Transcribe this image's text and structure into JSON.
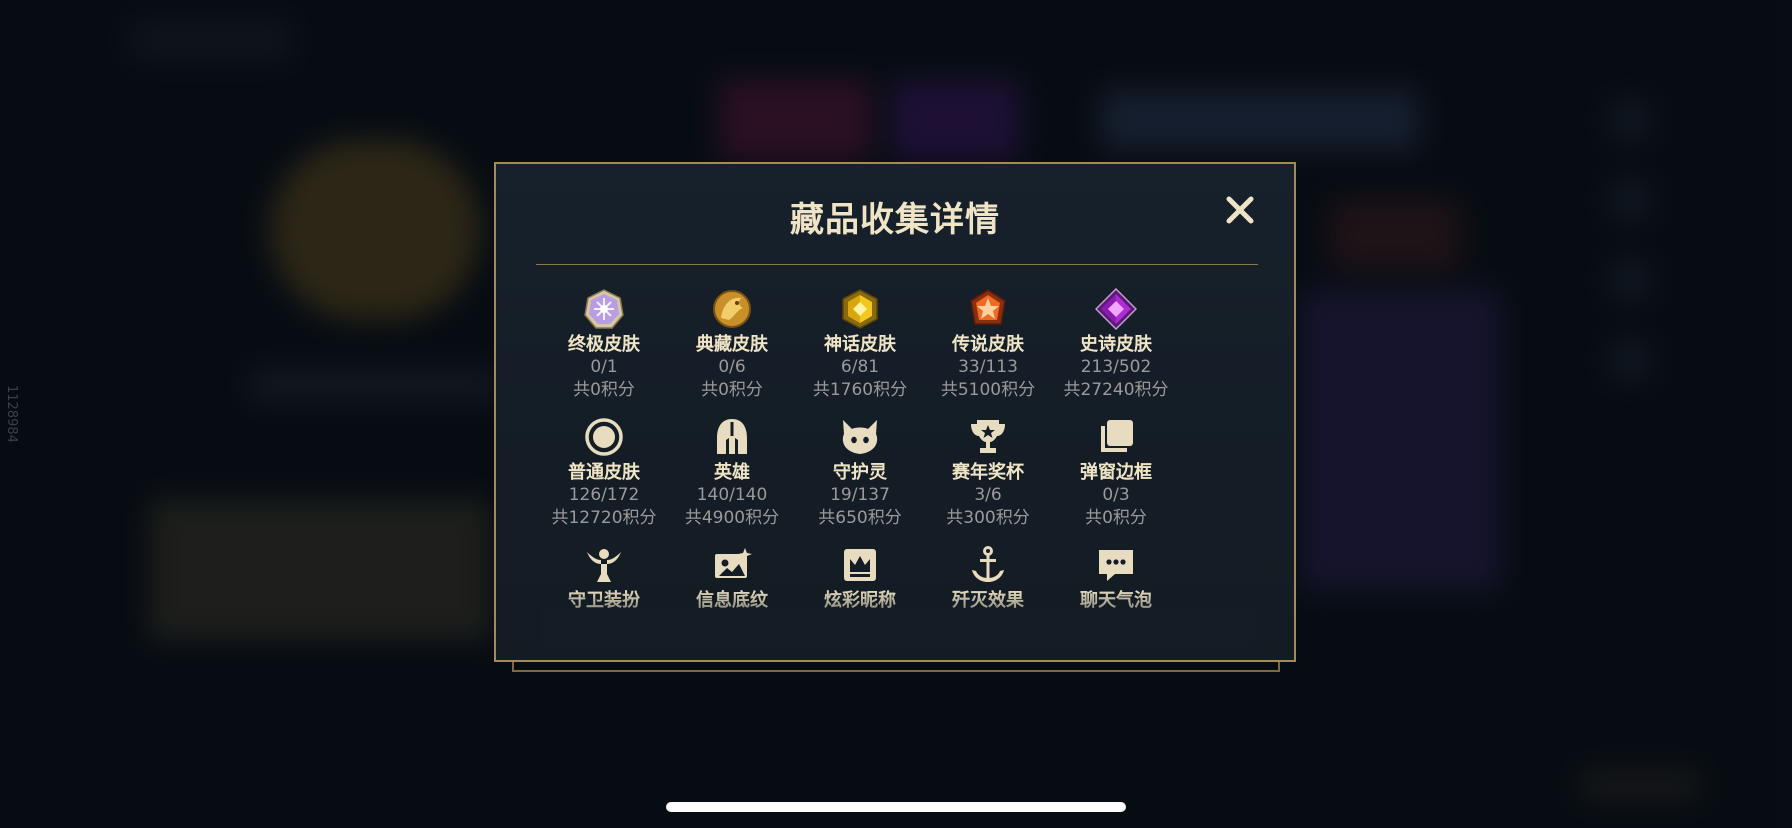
{
  "side_id": "1128984",
  "dialog": {
    "title": "藏品收集详情",
    "close_icon": "close-x-icon",
    "rows": [
      [
        {
          "icon": "ultimate-skin-icon",
          "name": "终极皮肤",
          "count": "0/1",
          "score": "共0积分"
        },
        {
          "icon": "collector-skin-icon",
          "name": "典藏皮肤",
          "count": "0/6",
          "score": "共0积分"
        },
        {
          "icon": "mythic-skin-icon",
          "name": "神话皮肤",
          "count": "6/81",
          "score": "共1760积分"
        },
        {
          "icon": "legendary-skin-icon",
          "name": "传说皮肤",
          "count": "33/113",
          "score": "共5100积分"
        },
        {
          "icon": "epic-skin-icon",
          "name": "史诗皮肤",
          "count": "213/502",
          "score": "共27240积分"
        }
      ],
      [
        {
          "icon": "normal-skin-icon",
          "name": "普通皮肤",
          "count": "126/172",
          "score": "共12720积分"
        },
        {
          "icon": "hero-helmet-icon",
          "name": "英雄",
          "count": "140/140",
          "score": "共4900积分"
        },
        {
          "icon": "spirit-icon",
          "name": "守护灵",
          "count": "19/137",
          "score": "共650积分"
        },
        {
          "icon": "trophy-icon",
          "name": "赛年奖杯",
          "count": "3/6",
          "score": "共300积分"
        },
        {
          "icon": "frame-icon",
          "name": "弹窗边框",
          "count": "0/3",
          "score": "共0积分"
        }
      ],
      [
        {
          "icon": "ward-icon",
          "name": "守卫装扮"
        },
        {
          "icon": "banner-icon",
          "name": "信息底纹"
        },
        {
          "icon": "crown-icon",
          "name": "炫彩昵称"
        },
        {
          "icon": "anchor-icon",
          "name": "歼灭效果"
        },
        {
          "icon": "chat-bubble-icon",
          "name": "聊天气泡"
        }
      ]
    ]
  },
  "colors": {
    "gold_border": "#a68a52",
    "title_text": "#f0e4c6",
    "sub_text": "#9a9a9a",
    "panel_bg": "#151e27"
  }
}
